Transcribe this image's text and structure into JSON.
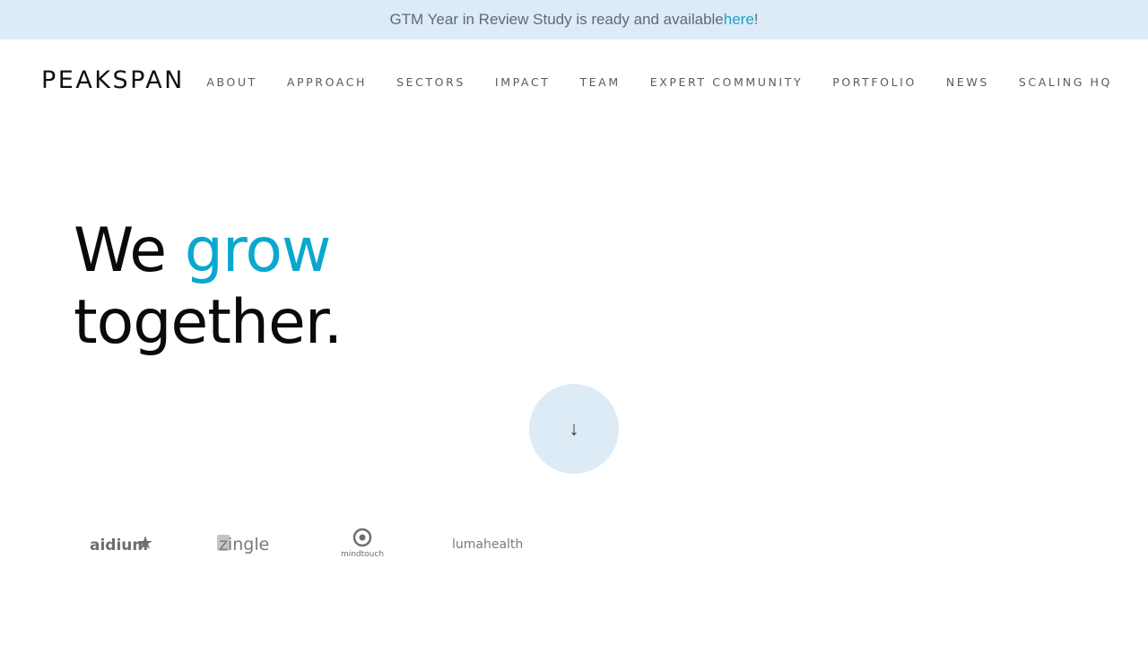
{
  "banner": {
    "text": "GTM Year in Review Study is ready and available ",
    "link": "here",
    "suffix": "!"
  },
  "logo": {
    "text": "PEAKSPAN"
  },
  "nav": {
    "items": [
      {
        "label": "ABOUT"
      },
      {
        "label": "APPROACH"
      },
      {
        "label": "SECTORS"
      },
      {
        "label": "IMPACT"
      },
      {
        "label": "TEAM"
      },
      {
        "label": "EXPERT COMMUNITY"
      },
      {
        "label": "PORTFOLIO"
      },
      {
        "label": "NEWS"
      },
      {
        "label": "SCALING HQ"
      }
    ]
  },
  "hero": {
    "line1_start": "We ",
    "line1_accent": "grow",
    "line2": "together."
  },
  "scroll_button": {
    "icon": "arrow-down-icon",
    "glyph": "↓"
  },
  "client_logos": [
    {
      "name": "aidium"
    },
    {
      "name": "zingle"
    },
    {
      "name": "mindtouch"
    },
    {
      "name": "lumahealth"
    }
  ],
  "colors": {
    "accent": "#0aa8cf",
    "banner_bg": "#ddebf7"
  }
}
